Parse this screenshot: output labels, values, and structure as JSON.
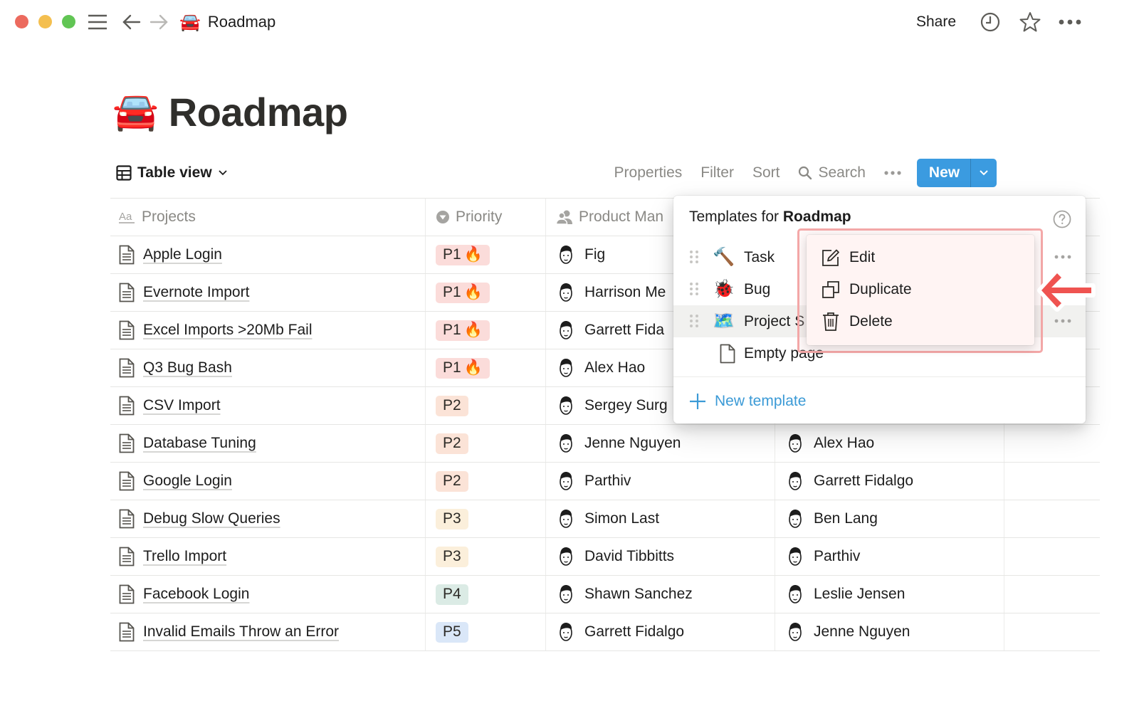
{
  "window": {
    "breadcrumb_emoji": "🚘",
    "breadcrumb_title": "Roadmap",
    "share_label": "Share"
  },
  "page": {
    "emoji": "🚘",
    "title": "Roadmap"
  },
  "toolbar": {
    "view_label": "Table view",
    "properties": "Properties",
    "filter": "Filter",
    "sort": "Sort",
    "search": "Search",
    "more": "•••",
    "new_label": "New"
  },
  "table": {
    "columns": [
      {
        "label": "Projects",
        "icon": "text-aa-icon"
      },
      {
        "label": "Priority",
        "icon": "select-icon"
      },
      {
        "label": "Product Man",
        "icon": "person-icon"
      }
    ],
    "rows": [
      {
        "project": "Apple Login",
        "priority": "P1",
        "fire": "🔥",
        "pm": "Fig",
        "eng": ""
      },
      {
        "project": "Evernote Import",
        "priority": "P1",
        "fire": "🔥",
        "pm": "Harrison Me",
        "eng": ""
      },
      {
        "project": "Excel Imports >20Mb Fail",
        "priority": "P1",
        "fire": "🔥",
        "pm": "Garrett Fida",
        "eng": ""
      },
      {
        "project": "Q3 Bug Bash",
        "priority": "P1",
        "fire": "🔥",
        "pm": "Alex Hao",
        "eng": ""
      },
      {
        "project": "CSV Import",
        "priority": "P2",
        "fire": "",
        "pm": "Sergey Surg",
        "eng": ""
      },
      {
        "project": "Database Tuning",
        "priority": "P2",
        "fire": "",
        "pm": "Jenne Nguyen",
        "eng": "Alex Hao"
      },
      {
        "project": "Google Login",
        "priority": "P2",
        "fire": "",
        "pm": "Parthiv",
        "eng": "Garrett Fidalgo"
      },
      {
        "project": "Debug Slow Queries",
        "priority": "P3",
        "fire": "",
        "pm": "Simon Last",
        "eng": "Ben Lang"
      },
      {
        "project": "Trello Import",
        "priority": "P3",
        "fire": "",
        "pm": "David Tibbitts",
        "eng": "Parthiv"
      },
      {
        "project": "Facebook Login",
        "priority": "P4",
        "fire": "",
        "pm": "Shawn Sanchez",
        "eng": "Leslie Jensen"
      },
      {
        "project": "Invalid Emails Throw an Error",
        "priority": "P5",
        "fire": "",
        "pm": "Garrett Fidalgo",
        "eng": "Jenne Nguyen"
      }
    ],
    "priority_colors": {
      "P1": "#fbdcda",
      "P2": "#fbe3d7",
      "P3": "#fbefdb",
      "P4": "#dbebe5",
      "P5": "#dae7f8"
    }
  },
  "templates": {
    "title_prefix": "Templates for ",
    "title_bold": "Roadmap",
    "items": [
      {
        "emoji": "🔨",
        "label": "Task"
      },
      {
        "emoji": "🐞",
        "label": "Bug"
      },
      {
        "emoji": "🗺️",
        "label": "Project S"
      },
      {
        "emoji": "",
        "label": "Empty page"
      }
    ],
    "new_template": "New template"
  },
  "context_menu": {
    "items": [
      {
        "label": "Edit",
        "icon": "edit-icon"
      },
      {
        "label": "Duplicate",
        "icon": "duplicate-icon"
      },
      {
        "label": "Delete",
        "icon": "trash-icon"
      }
    ]
  },
  "colors": {
    "accent": "#3b9be0",
    "link": "#3b9ad6",
    "annotation": "#ef5350"
  }
}
